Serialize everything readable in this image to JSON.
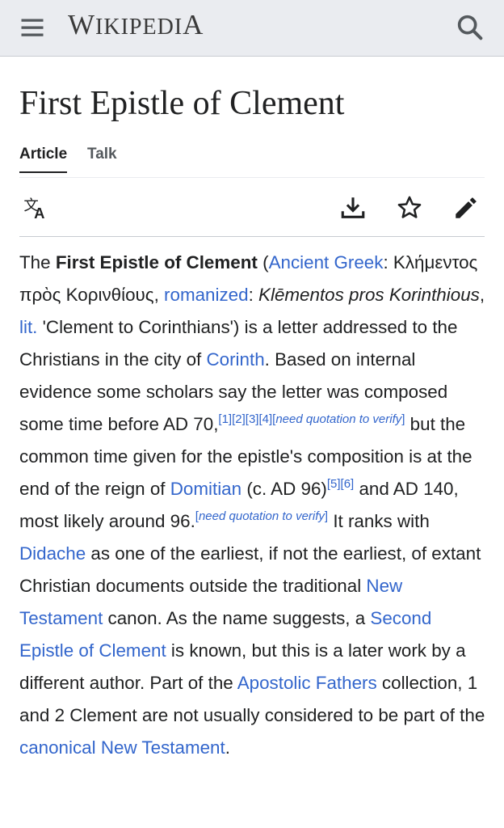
{
  "header": {
    "wordmark_big_w": "W",
    "wordmark_small": "IKIPEDI",
    "wordmark_big_a": "A"
  },
  "page": {
    "title": "First Epistle of Clement",
    "tabs": [
      "Article",
      "Talk"
    ]
  },
  "icons": {
    "menu": "hamburger-icon",
    "search": "search-icon",
    "language": "translate-icon",
    "download": "download-icon",
    "watch": "star-icon",
    "edit": "pencil-icon"
  },
  "article": {
    "t01": "The ",
    "b01": "First Epistle of Clement",
    "t02": " (",
    "l01": "Ancient Greek",
    "t03": ": Κλήμεντος πρὸς Κορινθίους, ",
    "l02": "romanized",
    "t04": ": ",
    "i01": "Klēmentos pros Korinthious",
    "t05": ", ",
    "l03": "lit.",
    "t06": " 'Clement to Corinthians') is a letter addressed to the Christians in the city of ",
    "l04": "Corinth",
    "t07": ". Based on internal evidence some scholars say the letter was composed some time before AD 70,",
    "s01": "[1][2][3][4]",
    "s02": "[",
    "s03": "need quotation to verify",
    "s04": "]",
    "t08": " but the common time given for the epistle's composition is at the end of the reign of ",
    "l05": "Domitian",
    "t09": " (c. AD 96)",
    "s05": "[5][6]",
    "t10": " and AD 140, most likely around 96.",
    "s06": "[",
    "s07": "need quotation to verify",
    "s08": "]",
    "t11": " It ranks with ",
    "l06": "Didache",
    "t12": " as one of the earliest, if not the earliest, of extant Christian documents outside the traditional ",
    "l07": "New Testament",
    "t13": " canon. As the name suggests, a ",
    "l08": "Second Epistle of Clement",
    "t14": " is known, but this is a later work by a different author. Part of the ",
    "l09": "Apostolic Fathers",
    "t15": " collection, 1 and 2 Clement are not usually considered to be part of the ",
    "l10": "canonical New Testament",
    "t16": "."
  },
  "colors": {
    "link": "#3366cc",
    "header_bg": "#eaecf0",
    "text": "#202122"
  }
}
